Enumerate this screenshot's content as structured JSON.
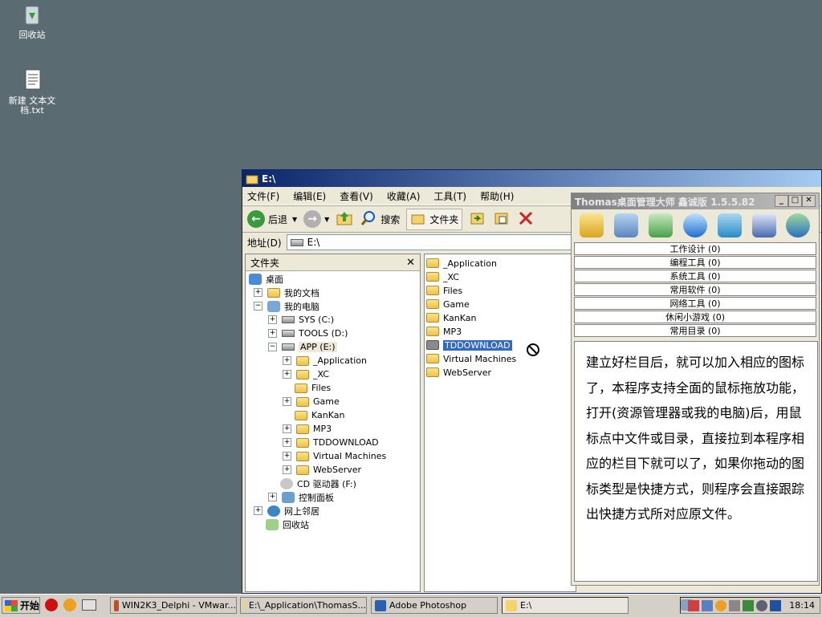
{
  "desktop": {
    "icons": [
      {
        "label": "回收站"
      },
      {
        "label": "新建 文本文档.txt"
      }
    ]
  },
  "explorer": {
    "title": "E:\\",
    "menu": [
      "文件(F)",
      "编辑(E)",
      "查看(V)",
      "收藏(A)",
      "工具(T)",
      "帮助(H)"
    ],
    "toolbar": {
      "back": "后退",
      "search": "搜索",
      "folders": "文件夹"
    },
    "address": {
      "label": "地址(D)",
      "value": "E:\\"
    },
    "folders_header": "文件夹",
    "tree": [
      {
        "label": "桌面"
      },
      {
        "label": "我的文档"
      },
      {
        "label": "我的电脑"
      },
      {
        "label": "SYS (C:)"
      },
      {
        "label": "TOOLS (D:)"
      },
      {
        "label": "APP (E:)"
      },
      {
        "label": "_Application"
      },
      {
        "label": "_XC"
      },
      {
        "label": "Files"
      },
      {
        "label": "Game"
      },
      {
        "label": "KanKan"
      },
      {
        "label": "MP3"
      },
      {
        "label": "TDDOWNLOAD"
      },
      {
        "label": "Virtual Machines"
      },
      {
        "label": "WebServer"
      },
      {
        "label": "CD 驱动器 (F:)"
      },
      {
        "label": "控制面板"
      },
      {
        "label": "网上邻居"
      },
      {
        "label": "回收站"
      }
    ],
    "files": [
      "_Application",
      "_XC",
      "Files",
      "Game",
      "KanKan",
      "MP3",
      "TDDOWNLOAD",
      "Virtual Machines",
      "WebServer"
    ],
    "selected_file": "TDDOWNLOAD"
  },
  "thomas": {
    "title": "Thomas桌面管理大师 鑫诚版 1.5.5.82",
    "categories": [
      "工作设计  (0)",
      "编程工具  (0)",
      "系统工具  (0)",
      "常用软件  (0)",
      "网络工具  (0)",
      "休闲小游戏  (0)",
      "常用目录  (0)"
    ],
    "help_text": "建立好栏目后，就可以加入相应的图标了，本程序支持全面的鼠标拖放功能，打开(资源管理器或我的电脑)后，用鼠标点中文件或目录，直接拉到本程序相应的栏目下就可以了，如果你拖动的图标类型是快捷方式，则程序会直接跟踪出快捷方式所对应原文件。"
  },
  "taskbar": {
    "start": "开始",
    "tasks": [
      {
        "label": "WIN2K3_Delphi - VMwar..."
      },
      {
        "label": "E:\\_Application\\ThomasS..."
      },
      {
        "label": "Adobe Photoshop"
      },
      {
        "label": "E:\\"
      }
    ],
    "clock": "18:14"
  },
  "colors": {
    "desktop": "#5b6b72",
    "title_active": "#0a246a",
    "selection": "#316ac5"
  }
}
